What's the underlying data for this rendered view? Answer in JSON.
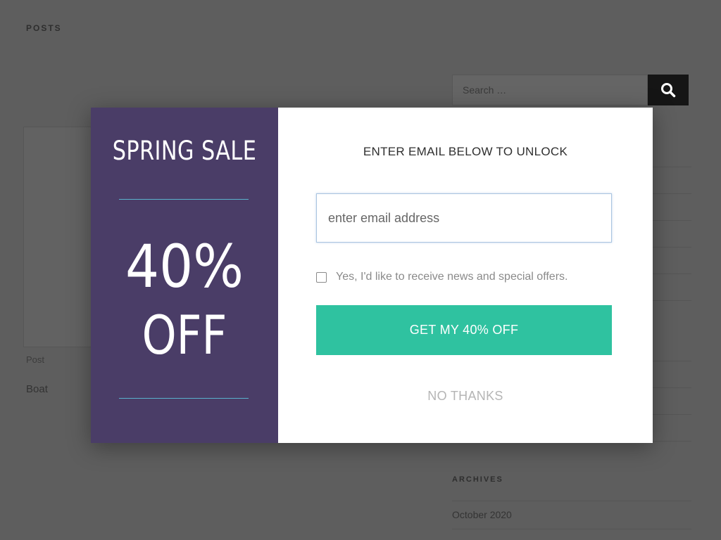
{
  "background_page": {
    "posts_heading": "POSTS",
    "post_meta": "Post",
    "post_title": "Boat",
    "search": {
      "placeholder": "Search …",
      "button_icon": "search-icon"
    },
    "archives_heading": "ARCHIVES",
    "archive_items": [
      "October 2020"
    ]
  },
  "popup": {
    "promo": {
      "headline": "SPRING SALE",
      "discount_value": "40%",
      "discount_suffix": "OFF",
      "background_color": "#4a3d67",
      "divider_color": "#5ab2cd"
    },
    "form": {
      "heading": "ENTER EMAIL BELOW TO UNLOCK",
      "email_placeholder": "enter email address",
      "email_value": "",
      "consent_checked": false,
      "consent_label": "Yes, I'd like to receive news and special offers.",
      "cta_label": "GET MY 40% OFF",
      "cta_color": "#2fc2a0",
      "decline_label": "NO THANKS"
    }
  }
}
